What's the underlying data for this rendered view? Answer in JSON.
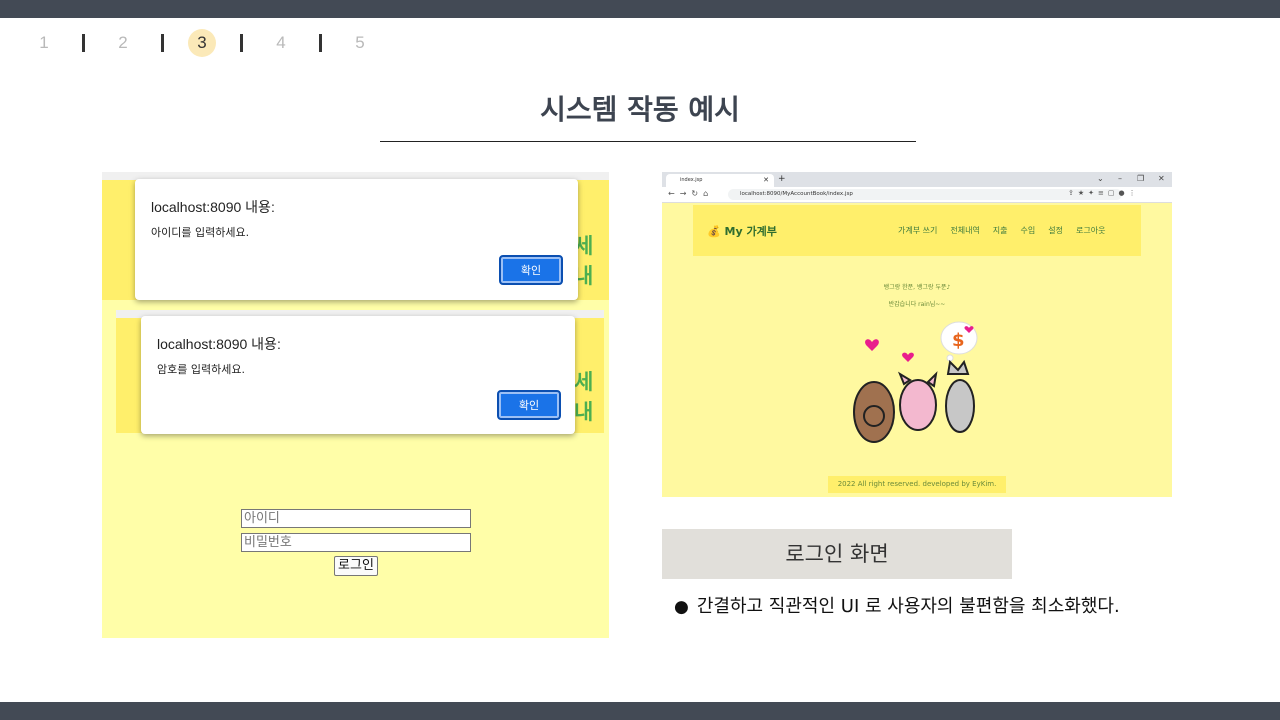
{
  "pager": {
    "pages": [
      "1",
      "2",
      "3",
      "4",
      "5"
    ],
    "active": 2
  },
  "slide": {
    "title": "시스템 작동 예시"
  },
  "left_screenshot": {
    "peek_text": "세내",
    "dialog1": {
      "title": "localhost:8090 내용:",
      "message": "아이디를 입력하세요.",
      "ok_label": "확인"
    },
    "dialog2": {
      "title": "localhost:8090 내용:",
      "message": "암호를 입력하세요.",
      "ok_label": "확인"
    },
    "login_form": {
      "id_placeholder": "아이디",
      "password_placeholder": "비밀번호",
      "submit_label": "로그인"
    }
  },
  "right_screenshot": {
    "tab_title": "index.jsp",
    "url": "localhost:8090/MyAccountBook/index.jsp",
    "site_logo": "💰 My 가계부",
    "menu": [
      "가계부 쓰기",
      "전체내역",
      "지출",
      "수입",
      "설정",
      "로그아웃"
    ],
    "greeting_line1": "뱅그랑 한푼, 뱅그랑 두푼♪",
    "greeting_line2": "반갑습니다 rain님~~",
    "footer": "2022 All right reserved. developed by EyKim."
  },
  "caption": "로그인 화면",
  "bullet": {
    "marker": "●",
    "text": "간결하고 직관적인 UI 로 사용자의 불편함을 최소화했다."
  }
}
